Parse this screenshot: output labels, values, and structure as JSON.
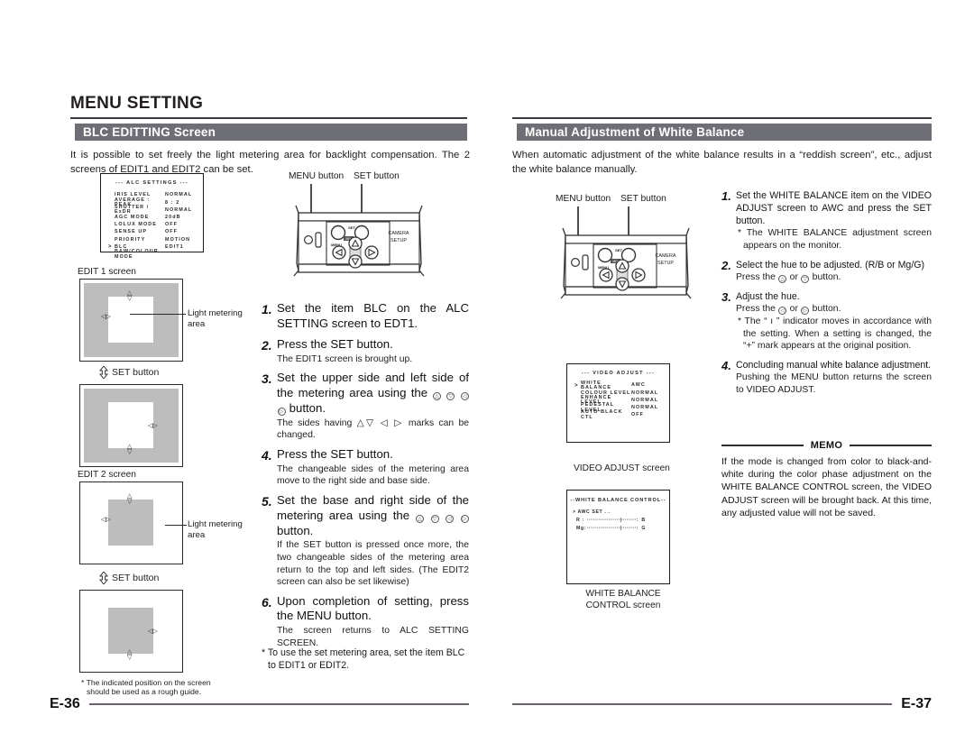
{
  "left_page": {
    "chapter_title": "MENU SETTING",
    "section_title": "BLC EDITTING Screen",
    "intro": "It is possible to set freely the light metering area for backlight compensation.  The 2 screens of EDIT1 and EDIT2 can be set.",
    "alc_menu": {
      "title": "--- ALC SETTINGS ---",
      "rows": [
        {
          "cursor": "",
          "label": "IRIS  LEVEL",
          "value": "NORMAL"
        },
        {
          "cursor": "",
          "label": "AVERAGE : PEAK",
          "value": "8 : 2"
        },
        {
          "cursor": "",
          "label": "SHUTTER / ExDR",
          "value": "NORMAL"
        },
        {
          "cursor": "",
          "label": "AGC  MODE",
          "value": "20dB"
        },
        {
          "cursor": "",
          "label": "LOLUX  MODE",
          "value": "OFF"
        },
        {
          "cursor": "",
          "label": "SENSE  UP",
          "value": "OFF"
        },
        {
          "cursor": "",
          "label": "PRIORITY",
          "value": "MOTION"
        },
        {
          "cursor": ">",
          "label": "BLC",
          "value": "EDIT1"
        },
        {
          "cursor": "",
          "label": "B&W/COLOUR MODE",
          "value": ""
        }
      ]
    },
    "camera_labels": {
      "menu_button": "MENU button",
      "set_button": "SET button",
      "menu_small": "MENU",
      "set_small": "SET",
      "mix_small": "MIX",
      "camera_setup": "CAMERA\nSETUP"
    },
    "edit1_caption": "EDIT 1 screen",
    "edit2_caption": "EDIT 2 screen",
    "set_button_note": "SET button",
    "light_metering_label": "Light metering\narea",
    "steps": [
      {
        "num": "1.",
        "main": "Set the item BLC on the ALC SETTING screen to EDT1.",
        "sub": ""
      },
      {
        "num": "2.",
        "main": "Press the SET button.",
        "sub": "The EDIT1 screen is brought up."
      },
      {
        "num": "3.",
        "main": "Set the upper side and left side of the metering area using the",
        "main_tail": "button.",
        "buttons": [
          "A",
          "V",
          "<",
          ">"
        ],
        "sub": "The sides having △▽ ◁ ▷ marks can be changed."
      },
      {
        "num": "4.",
        "main": "Press the SET button.",
        "sub": "The changeable sides of the metering area move to the right side and base side."
      },
      {
        "num": "5.",
        "main": "Set the base and right side of the metering area using the",
        "main_tail": "button.",
        "buttons": [
          "A",
          "V",
          "<",
          ">"
        ],
        "sub": "If the SET button is pressed once more, the two changeable sides of the metering area return to the top and left sides. (The EDIT2 screen can also be set likewise)"
      },
      {
        "num": "6.",
        "main": "Upon completion of setting, press the MENU button.",
        "sub": "The screen returns to ALC SETTING SCREEN."
      }
    ],
    "footnote_steps": "* To use the set metering area, set the item BLC to EDIT1 or EDIT2.",
    "footnote_diagram": "* The indicated position on the screen should be used as a rough guide.",
    "page_number": "E-36"
  },
  "right_page": {
    "section_title": "Manual Adjustment of White Balance",
    "intro": "When automatic adjustment of the white balance results in a “reddish screen”, etc., adjust the white balance manually.",
    "camera_labels": {
      "menu_button": "MENU button",
      "set_button": "SET button",
      "menu_small": "MENU",
      "set_small": "SET",
      "mix_small": "MIX",
      "camera_setup": "CAMERA\nSETUP"
    },
    "video_adjust_menu": {
      "title": "--- VIDEO ADJUST ---",
      "rows": [
        {
          "cursor": ">",
          "label": "WHITE BALANCE",
          "value": "AWC"
        },
        {
          "cursor": "",
          "label": "COLOUR LEVEL",
          "value": "NORMAL"
        },
        {
          "cursor": "",
          "label": "ENHANCE LEVEL",
          "value": "NORMAL"
        },
        {
          "cursor": "",
          "label": "PEDESTAL LEVEL",
          "value": "NORMAL"
        },
        {
          "cursor": "",
          "label": "AUTO BLACK CTL",
          "value": "OFF"
        }
      ]
    },
    "video_adjust_caption": "VIDEO ADJUST screen",
    "wb_control_menu": {
      "title": "--WHITE BALANCE CONTROL--",
      "cursor_row": "> AWC  SET . .",
      "bars": [
        {
          "left": "R  :",
          "track": "····················|·········:",
          "right": "B"
        },
        {
          "left": "Mg:",
          "track": "····················|·········:",
          "right": "G"
        }
      ]
    },
    "wb_control_caption": "WHITE BALANCE\nCONTROL screen",
    "steps": [
      {
        "num": "1.",
        "main": "Set the WHITE BALANCE item on the VIDEO ADJUST screen to AWC and press the SET button.",
        "sub2": "* The WHITE BALANCE adjustment screen appears on the monitor."
      },
      {
        "num": "2.",
        "main": "Select the hue to be adjusted. (R/B or Mg/G)",
        "sub_pre": "Press the",
        "sub_mid": "or",
        "sub_post": "button.",
        "buttons": [
          "A",
          "V"
        ]
      },
      {
        "num": "3.",
        "main": "Adjust the hue.",
        "sub_pre": "Press the",
        "sub_mid": "or",
        "sub_post": "button.",
        "buttons": [
          "<",
          ">"
        ],
        "sub2": "* The “ ı ” indicator moves in accordance with the setting. When a setting is changed, the “+” mark appears at the original position."
      },
      {
        "num": "4.",
        "main": "Concluding manual white balance adjustment.",
        "sub": "Pushing the MENU button returns the screen to VIDEO ADJUST."
      }
    ],
    "memo_label": "MEMO",
    "memo_body": "If the mode is changed from color to black-and-white during the color phase adjustment on the WHITE BALANCE CONTROL screen, the VIDEO ADJUST screen will be brought back.  At this time, any adjusted value will not be saved.",
    "page_number": "E-37"
  },
  "colors": {
    "section_bar": "#6e6e76",
    "footer_rule": "#6c5f6e",
    "gray_area": "#bdbdbd",
    "text": "#1a1a1a"
  }
}
